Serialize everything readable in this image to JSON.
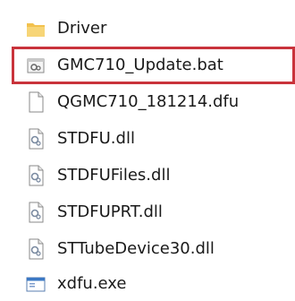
{
  "files": [
    {
      "name": "Driver",
      "icon": "folder-icon"
    },
    {
      "name": "GMC710_Update.bat",
      "icon": "batch-file-icon"
    },
    {
      "name": "QGMC710_181214.dfu",
      "icon": "blank-file-icon"
    },
    {
      "name": "STDFU.dll",
      "icon": "dll-file-icon"
    },
    {
      "name": "STDFUFiles.dll",
      "icon": "dll-file-icon"
    },
    {
      "name": "STDFUPRT.dll",
      "icon": "dll-file-icon"
    },
    {
      "name": "STTubeDevice30.dll",
      "icon": "dll-file-icon"
    },
    {
      "name": "xdfu.exe",
      "icon": "exe-file-icon"
    }
  ],
  "highlight_color": "#c9333b"
}
